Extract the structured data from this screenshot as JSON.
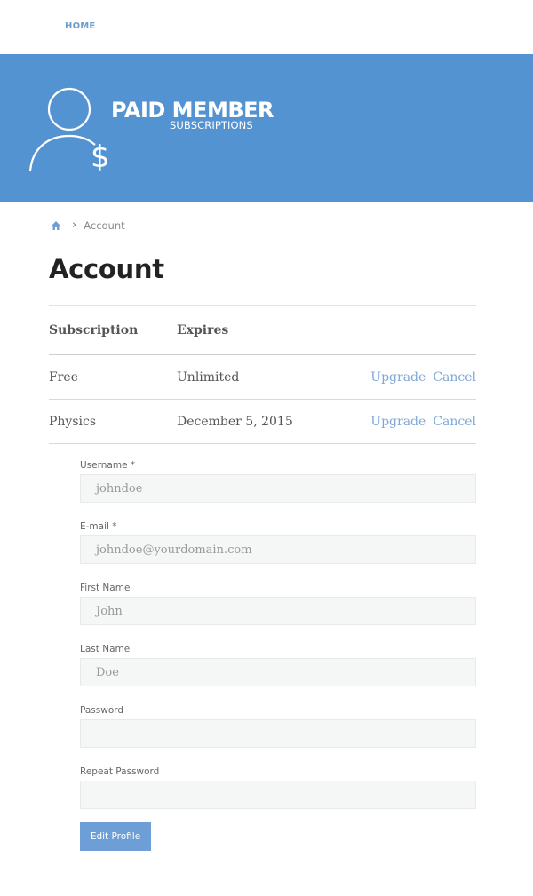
{
  "nav": {
    "home": "HOME"
  },
  "brand": {
    "main": "PAID MEMBER",
    "sub": "SUBSCRIPTIONS"
  },
  "breadcrumb": {
    "current": "Account",
    "separator": "›"
  },
  "page": {
    "title": "Account"
  },
  "subscriptions": {
    "headers": [
      "Subscription",
      "Expires"
    ],
    "rows": [
      {
        "name": "Free",
        "expires": "Unlimited",
        "upgrade": "Upgrade",
        "cancel": "Cancel"
      },
      {
        "name": "Physics",
        "expires": "December 5, 2015",
        "upgrade": "Upgrade",
        "cancel": "Cancel"
      }
    ]
  },
  "form": {
    "username_label": "Username *",
    "username_value": "johndoe",
    "email_label": "E-mail *",
    "email_value": "johndoe@yourdomain.com",
    "first_name_label": "First Name",
    "first_name_value": "John",
    "last_name_label": "Last Name",
    "last_name_value": "Doe",
    "password_label": "Password",
    "password_value": "",
    "repeat_password_label": "Repeat Password",
    "repeat_password_value": "",
    "submit_label": "Edit Profile"
  },
  "colors": {
    "brand_blue": "#5493d1",
    "link_blue": "#7fa7d6",
    "button_blue": "#6d9fd6"
  }
}
